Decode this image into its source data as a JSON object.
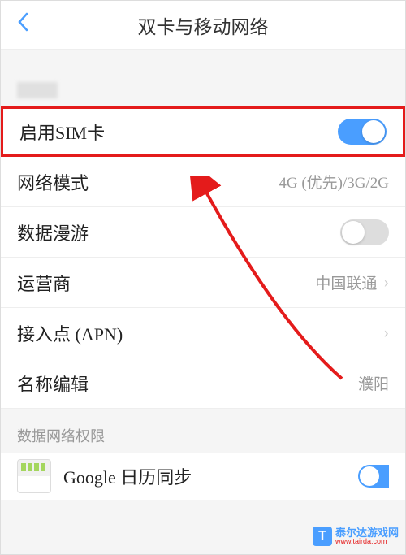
{
  "header": {
    "title": "双卡与移动网络"
  },
  "rows": {
    "enable_sim": {
      "label": "启用SIM卡",
      "toggle": true
    },
    "network_mode": {
      "label": "网络模式",
      "value": "4G (优先)/3G/2G"
    },
    "data_roaming": {
      "label": "数据漫游",
      "toggle": false
    },
    "carrier": {
      "label": "运营商",
      "value": "中国联通"
    },
    "apn": {
      "label": "接入点 (APN)"
    },
    "name_edit": {
      "label": "名称编辑",
      "value": "濮阳"
    }
  },
  "section": {
    "data_permission": "数据网络权限",
    "google_calendar": "Google 日历同步"
  },
  "watermark": {
    "cn": "泰尔达游戏网",
    "en": "www.tairda.com"
  }
}
